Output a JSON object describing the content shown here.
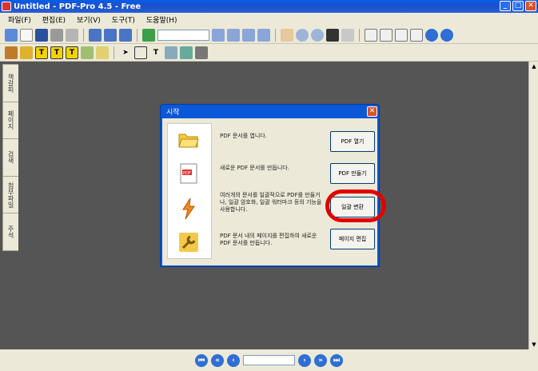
{
  "window": {
    "title": "Untitled - PDF-Pro 4.5 - Free",
    "min": "_",
    "max": "□",
    "close": "✕"
  },
  "menu": [
    "파일(F)",
    "편집(E)",
    "보기(V)",
    "도구(T)",
    "도움말(H)"
  ],
  "sidetabs": [
    "책갈피",
    "페이지",
    "검색",
    "첨부파일",
    "주석"
  ],
  "dialog": {
    "title": "시작",
    "close": "✕",
    "options": [
      {
        "text": "PDF 문서를 엽니다.",
        "button": "PDF 열기",
        "icon": "folder-open-icon"
      },
      {
        "text": "새로운 PDF 문서를 만듭니다.",
        "button": "PDF 만들기",
        "icon": "pdf-document-icon"
      },
      {
        "text": "여러개의 문서를 일괄적으로 PDF를 만들거나, 일괄 암호화, 일괄 워터마크 등의 기능을 사용합니다.",
        "button": "일괄 변환",
        "icon": "lightning-icon"
      },
      {
        "text": "PDF 문서 내의 페이지를 편집하여 새로운 PDF 문서를 만듭니다.",
        "button": "페이지 편집",
        "icon": "wrench-icon"
      }
    ]
  },
  "colors": {
    "workspace": "#555555",
    "highlight": "#e00000",
    "titlebar": "#0a5ee8"
  }
}
